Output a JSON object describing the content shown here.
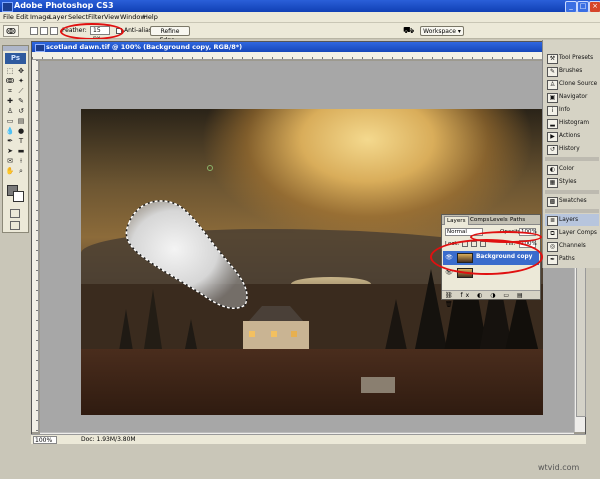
{
  "window": {
    "title": "Adobe Photoshop CS3",
    "controls": [
      "_",
      "□",
      "×"
    ]
  },
  "menu": [
    "File",
    "Edit",
    "Image",
    "Layer",
    "Select",
    "Filter",
    "View",
    "Window",
    "Help"
  ],
  "options": {
    "feather_label": "Feather:",
    "feather_value": "15 px",
    "antialias_label": "Anti-alias",
    "refine_edge": "Refine Edge...",
    "workspace": "Workspace ▾"
  },
  "document": {
    "title": "scotland dawn.tif @ 100% (Background copy, RGB/8*)",
    "zoom": "100%",
    "doc_info": "Doc: 1.93M/3.80M"
  },
  "toolbox": {
    "logo": "Ps"
  },
  "dock": {
    "items": [
      "Tool Presets",
      "Brushes",
      "Clone Source",
      "Navigator",
      "Info",
      "Histogram",
      "Actions",
      "History",
      "Color",
      "Styles",
      "Swatches",
      "Layers",
      "Layer Comps",
      "Channels",
      "Paths"
    ]
  },
  "layers_panel": {
    "tabs": [
      "Layers",
      "Comps",
      "Levels",
      "Paths"
    ],
    "blend_mode": "Normal",
    "opacity_label": "Opacity:",
    "opacity": "100%",
    "lock_label": "Lock:",
    "fill_label": "Fill:",
    "fill": "100%",
    "layers": [
      {
        "name": "Background copy",
        "selected": true
      }
    ]
  },
  "colors": {
    "accent_red": "#e01010",
    "title_blue": "#1546b9",
    "selected_layer": "#3a6ccc"
  },
  "watermark": "wtvid.com"
}
